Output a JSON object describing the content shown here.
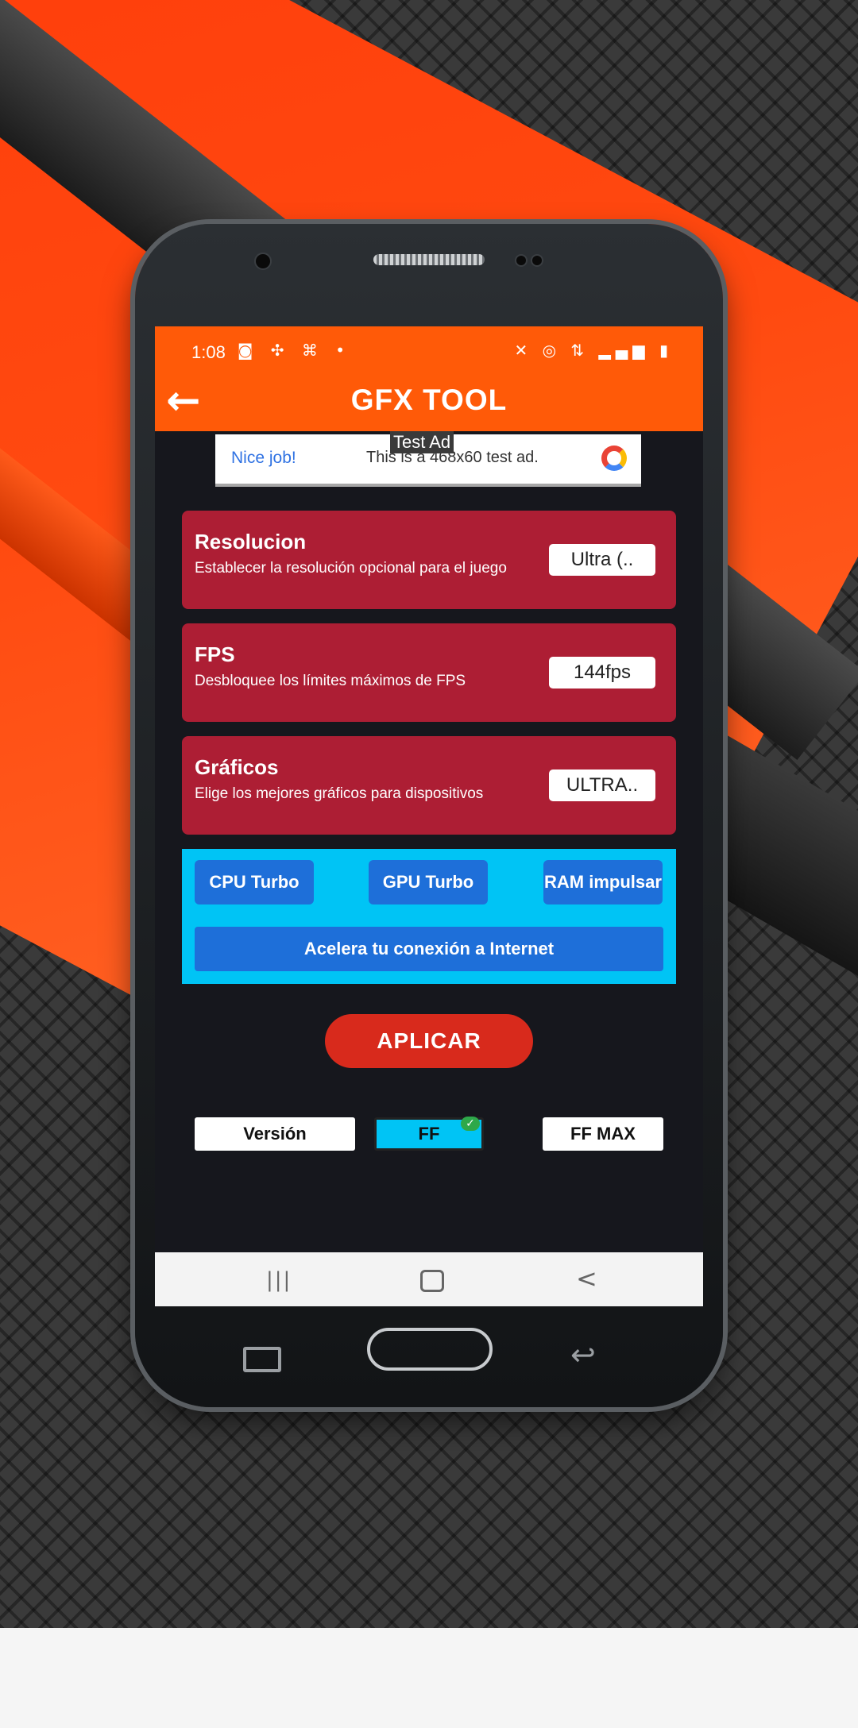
{
  "status_bar": {
    "time": "1:08",
    "left_icons": [
      "camera-icon",
      "crosshair-icon",
      "gamepad-icon",
      "dot-icon"
    ],
    "right_icons": [
      "mute-icon",
      "hotspot-icon",
      "lte-icon",
      "signal-icon",
      "battery-icon"
    ],
    "left_glyphs": "◙ ✣ ⌘ •",
    "right_glyphs": "✕ ◎ ⇅ ▂▄▆ ▮"
  },
  "app_bar": {
    "back_glyph": "←",
    "title": "GFX TOOL",
    "color": "#ff5a08"
  },
  "ad": {
    "label": "Test Ad",
    "headline": "Nice job!",
    "text": "This is a 468x60 test ad."
  },
  "settings": [
    {
      "title": "Resolucion",
      "description": "Establecer la resolución opcional para el juego",
      "value": "Ultra (.."
    },
    {
      "title": "FPS",
      "description": "Desbloquee los límites máximos de FPS",
      "value": "144fps"
    },
    {
      "title": "Gráficos",
      "description": "Elige los mejores gráficos para dispositivos",
      "value": "ULTRA.."
    }
  ],
  "boost": {
    "cpu": "CPU Turbo",
    "gpu": "GPU Turbo",
    "ram": "RAM impulsar",
    "internet": "Acelera tu conexión a Internet"
  },
  "apply_label": "APLICAR",
  "versions": {
    "label": "Versión",
    "ff": "FF",
    "ff_max": "FF MAX",
    "selected": "FF",
    "check_glyph": "✓"
  },
  "nav": {
    "recents": "|||",
    "back": "<",
    "hw_back": "↩"
  },
  "colors": {
    "card": "#ad1e34",
    "boost_panel": "#00c4f5",
    "boost_button": "#1e6fd9",
    "apply": "#d82a1c"
  }
}
